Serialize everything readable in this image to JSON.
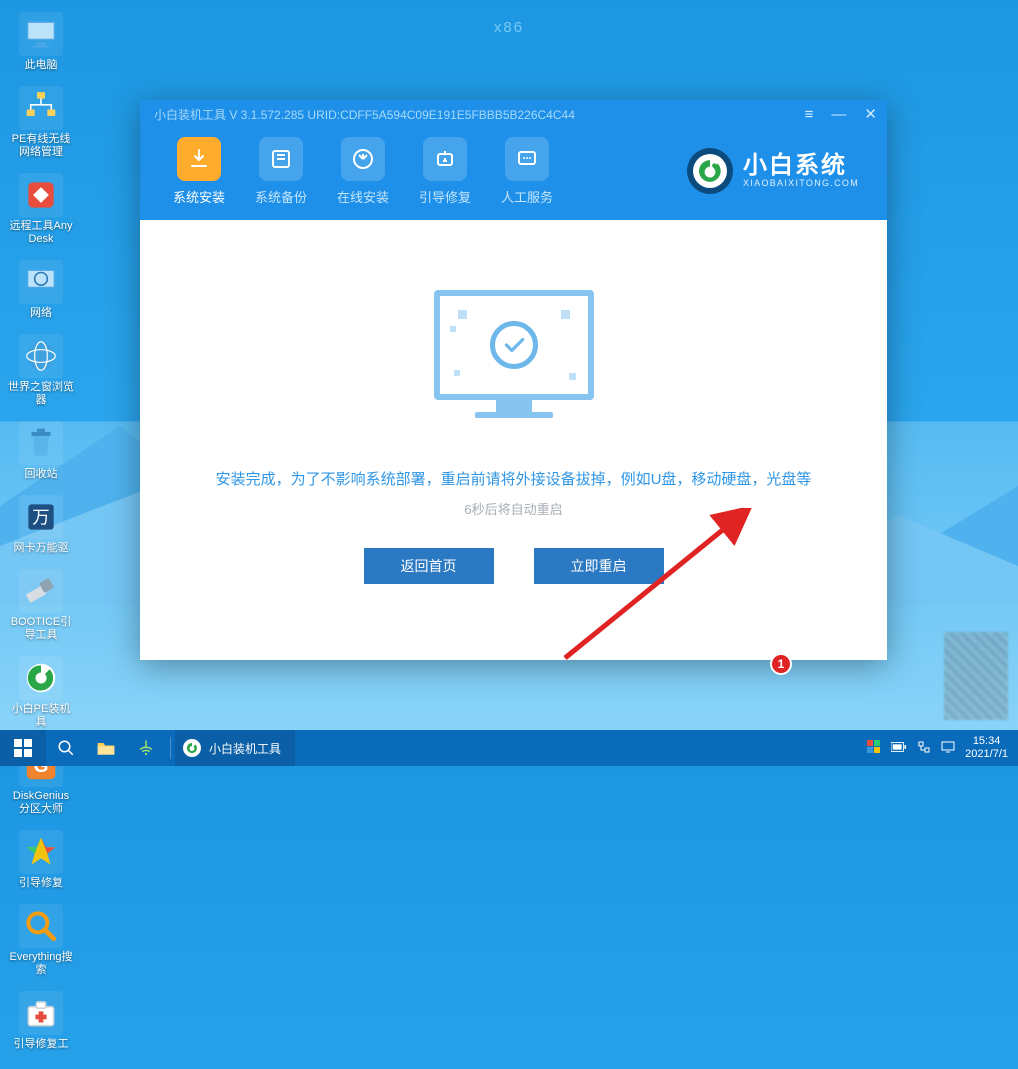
{
  "arch": "x86",
  "desktop": [
    {
      "name": "此电脑",
      "icon": "pc"
    },
    {
      "name": "PE有线无线网络管理",
      "icon": "net"
    },
    {
      "name": "远程工具AnyDesk",
      "icon": "anydesk"
    },
    {
      "name": "网络",
      "icon": "netfolder"
    },
    {
      "name": "世界之窗浏览器",
      "icon": "browser"
    },
    {
      "name": "回收站",
      "icon": "recycle"
    },
    {
      "name": "网卡万能驱",
      "icon": "wan"
    },
    {
      "name": "BOOTICE引导工具",
      "icon": "bootice"
    },
    {
      "name": "小白PE装机具",
      "icon": "xbpe"
    },
    {
      "name": "DiskGenius分区大师",
      "icon": "dg"
    },
    {
      "name": "引导修复",
      "icon": "bootfix"
    },
    {
      "name": "Everything搜索",
      "icon": "everything"
    },
    {
      "name": "引导修复工",
      "icon": "firstaid"
    }
  ],
  "window": {
    "title": "小白装机工具 V 3.1.572.285 URID:CDFF5A594C09E191E5FBBB5B226C4C44",
    "tabs": [
      {
        "label": "系统安装",
        "icon": "install",
        "active": true
      },
      {
        "label": "系统备份",
        "icon": "backup"
      },
      {
        "label": "在线安装",
        "icon": "online"
      },
      {
        "label": "引导修复",
        "icon": "boot"
      },
      {
        "label": "人工服务",
        "icon": "service"
      }
    ],
    "brand": {
      "name": "小白系统",
      "url": "XIAOBAIXITONG.COM"
    },
    "message": "安装完成，为了不影响系统部署，重启前请将外接设备拔掉，例如U盘，移动硬盘，光盘等",
    "countdown": "6秒后将自动重启",
    "buttons": {
      "home": "返回首页",
      "reboot": "立即重启"
    }
  },
  "annotation": {
    "badge": "1"
  },
  "taskbar": {
    "app": {
      "label": "小白装机工具"
    },
    "time": "15:34",
    "date": "2021/7/1"
  }
}
